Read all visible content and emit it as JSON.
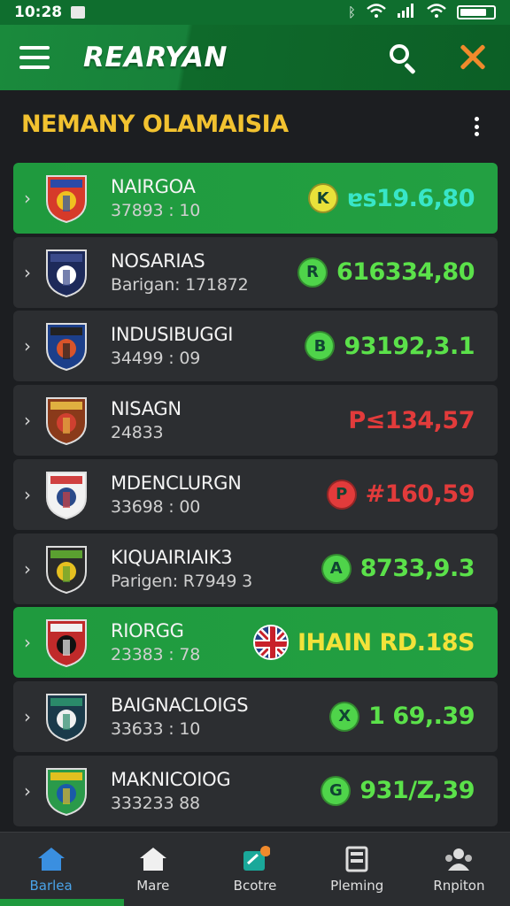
{
  "status_bar": {
    "time": "10:28",
    "battery_level": 0.8
  },
  "header": {
    "title": "REARYAN"
  },
  "section": {
    "title": "NEMANY OLAMAISIA"
  },
  "rows": [
    {
      "name": "NAIRGOA",
      "sub": "37893 : 10",
      "badge": "K",
      "badge_color": "#e9e13a",
      "amount": "ɐs19.6,80",
      "amount_color": "#38e6c8",
      "highlight": true,
      "crest": "crest-red-yellow"
    },
    {
      "name": "NOSARIAS",
      "sub": "Barigan: 171872",
      "badge": "R",
      "badge_color": "#4fd44a",
      "amount": "616334,80",
      "amount_color": "#5be14a",
      "highlight": false,
      "crest": "crest-navy"
    },
    {
      "name": "INDUSIBUGGI",
      "sub": "34499 : 09",
      "badge": "B",
      "badge_color": "#4fd44a",
      "amount": "93192,3.1",
      "amount_color": "#5be14a",
      "highlight": false,
      "crest": "crest-blue-orange"
    },
    {
      "name": "NISAGN",
      "sub": "24833",
      "badge": "",
      "badge_color": "",
      "amount": "P≤134,57",
      "amount_color": "#e23b3b",
      "highlight": false,
      "crest": "crest-photo"
    },
    {
      "name": "MDENCLURGN",
      "sub": "33698 : 00",
      "badge": "P",
      "badge_color": "#e23b3b",
      "amount": "#160,59",
      "amount_color": "#e23b3b",
      "highlight": false,
      "crest": "crest-white"
    },
    {
      "name": "KIQUAIRIAIK3",
      "sub": "Parigen: R7949 3",
      "badge": "A",
      "badge_color": "#4fd44a",
      "amount": "8733,9.3",
      "amount_color": "#5be14a",
      "highlight": false,
      "crest": "crest-dark-yellow"
    },
    {
      "name": "RIORGG",
      "sub": "23383 : 78",
      "badge": "",
      "badge_color": "",
      "amount": "IHAIN RD.18S",
      "amount_color": "#f2e23a",
      "highlight": true,
      "crest": "crest-red-black",
      "flag": true
    },
    {
      "name": "BAIGNACLOIGS",
      "sub": "33633 : 10",
      "badge": "X",
      "badge_color": "#4fd44a",
      "amount": "1 69,.39",
      "amount_color": "#5be14a",
      "highlight": false,
      "crest": "crest-teal"
    },
    {
      "name": "MAKNICOIOG",
      "sub": "333233 88",
      "badge": "G",
      "badge_color": "#4fd44a",
      "amount": "931/Z,39",
      "amount_color": "#5be14a",
      "highlight": false,
      "crest": "crest-green-blue"
    }
  ],
  "nav": [
    {
      "label": "Barlea",
      "icon": "home-filled-icon",
      "active": true
    },
    {
      "label": "Mare",
      "icon": "home-icon",
      "active": false
    },
    {
      "label": "Bcotre",
      "icon": "score-icon",
      "active": false
    },
    {
      "label": "Pleming",
      "icon": "printer-icon",
      "active": false
    },
    {
      "label": "Rnpiton",
      "icon": "users-icon",
      "active": false
    }
  ]
}
